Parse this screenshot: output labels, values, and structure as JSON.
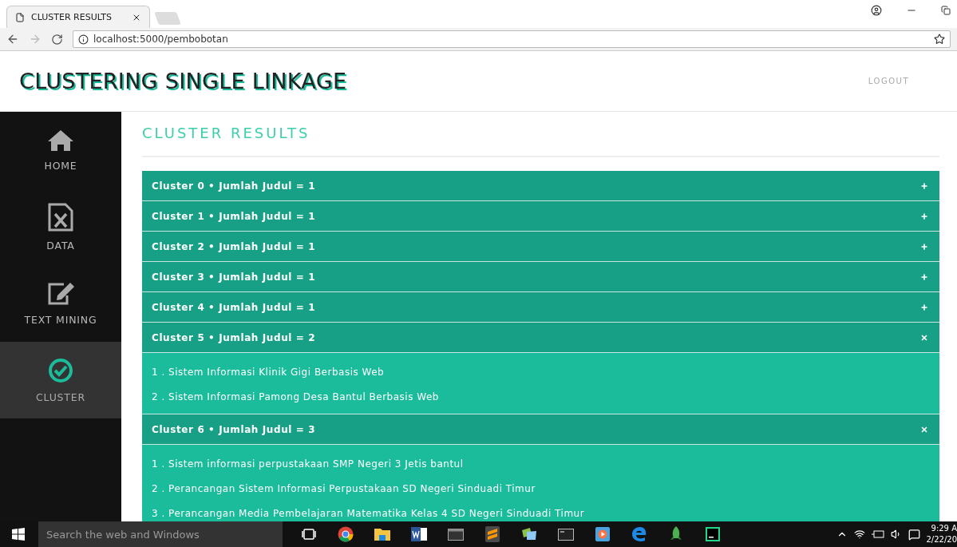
{
  "browser": {
    "tab_title": "CLUSTER RESULTS",
    "url": "localhost:5000/pembobotan"
  },
  "header": {
    "title": "CLUSTERING SINGLE LINKAGE",
    "logout": "LOGOUT"
  },
  "sidebar": {
    "items": [
      {
        "label": "HOME",
        "kind": "home",
        "selected": false
      },
      {
        "label": "DATA",
        "kind": "file",
        "selected": false
      },
      {
        "label": "TEXT MINING",
        "kind": "edit",
        "selected": false
      },
      {
        "label": "CLUSTER",
        "kind": "check",
        "selected": true
      }
    ]
  },
  "page_title": "CLUSTER RESULTS",
  "clusters": [
    {
      "title": "Cluster 0 • Jumlah Judul = 1",
      "expanded": false
    },
    {
      "title": "Cluster 1 • Jumlah Judul = 1",
      "expanded": false
    },
    {
      "title": "Cluster 2 • Jumlah Judul = 1",
      "expanded": false
    },
    {
      "title": "Cluster 3 • Jumlah Judul = 1",
      "expanded": false
    },
    {
      "title": "Cluster 4 • Jumlah Judul = 1",
      "expanded": false
    },
    {
      "title": "Cluster 5 • Jumlah Judul = 2",
      "expanded": true,
      "items": [
        "1 . Sistem Informasi Klinik Gigi Berbasis Web",
        "2 . Sistem Informasi Pamong Desa Bantul Berbasis Web"
      ]
    },
    {
      "title": "Cluster 6 • Jumlah Judul = 3",
      "expanded": true,
      "items": [
        "1 . Sistem informasi perpustakaan SMP Negeri 3 Jetis bantul",
        "2 . Perancangan Sistem Informasi Perpustakaan SD Negeri Sinduadi Timur",
        "3 . Perancangan Media Pembelajaran Matematika Kelas 4 SD Negeri Sinduadi Timur"
      ]
    }
  ],
  "taskbar": {
    "search_placeholder": "Search the web and Windows",
    "time": "9:29 A",
    "date": "2/22/20"
  }
}
